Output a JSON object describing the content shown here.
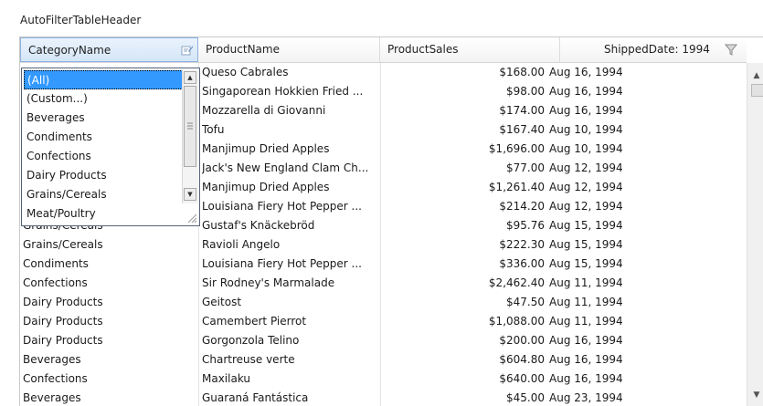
{
  "title": "AutoFilterTableHeader",
  "headers": {
    "category": "CategoryName",
    "product": "ProductName",
    "sales": "ProductSales",
    "shipped": "ShippedDate: 1994"
  },
  "dropdown": {
    "items": [
      "(All)",
      "(Custom...)",
      "Beverages",
      "Condiments",
      "Confections",
      "Dairy Products",
      "Grains/Cereals",
      "Meat/Poultry"
    ],
    "selected": "(All)"
  },
  "rows": [
    {
      "category": "",
      "product": "Queso Cabrales",
      "sales": "$168.00",
      "date": "Aug 16, 1994"
    },
    {
      "category": "",
      "product": "Singaporean Hokkien Fried ...",
      "sales": "$98.00",
      "date": "Aug 16, 1994"
    },
    {
      "category": "",
      "product": "Mozzarella di Giovanni",
      "sales": "$174.00",
      "date": "Aug 16, 1994"
    },
    {
      "category": "",
      "product": "Tofu",
      "sales": "$167.40",
      "date": "Aug 10, 1994"
    },
    {
      "category": "",
      "product": "Manjimup Dried Apples",
      "sales": "$1,696.00",
      "date": "Aug 10, 1994"
    },
    {
      "category": "",
      "product": "Jack's New England Clam Ch...",
      "sales": "$77.00",
      "date": "Aug 12, 1994"
    },
    {
      "category": "",
      "product": "Manjimup Dried Apples",
      "sales": "$1,261.40",
      "date": "Aug 12, 1994"
    },
    {
      "category": "",
      "product": "Louisiana Fiery Hot Pepper ...",
      "sales": "$214.20",
      "date": "Aug 12, 1994"
    },
    {
      "category": "Grains/Cereals",
      "product": "Gustaf's Knäckebröd",
      "sales": "$95.76",
      "date": "Aug 15, 1994"
    },
    {
      "category": "Grains/Cereals",
      "product": "Ravioli Angelo",
      "sales": "$222.30",
      "date": "Aug 15, 1994"
    },
    {
      "category": "Condiments",
      "product": "Louisiana Fiery Hot Pepper ...",
      "sales": "$336.00",
      "date": "Aug 15, 1994"
    },
    {
      "category": "Confections",
      "product": "Sir Rodney's Marmalade",
      "sales": "$2,462.40",
      "date": "Aug 11, 1994"
    },
    {
      "category": "Dairy Products",
      "product": "Geitost",
      "sales": "$47.50",
      "date": "Aug 11, 1994"
    },
    {
      "category": "Dairy Products",
      "product": "Camembert Pierrot",
      "sales": "$1,088.00",
      "date": "Aug 11, 1994"
    },
    {
      "category": "Dairy Products",
      "product": "Gorgonzola Telino",
      "sales": "$200.00",
      "date": "Aug 16, 1994"
    },
    {
      "category": "Beverages",
      "product": "Chartreuse verte",
      "sales": "$604.80",
      "date": "Aug 16, 1994"
    },
    {
      "category": "Confections",
      "product": "Maxilaku",
      "sales": "$640.00",
      "date": "Aug 16, 1994"
    },
    {
      "category": "Beverages",
      "product": "Guaraná Fantástica",
      "sales": "$45.00",
      "date": "Aug 23, 1994"
    }
  ],
  "icons": {
    "category_filter": "filter-edit-icon",
    "shipped_filter": "funnel-icon"
  },
  "colors": {
    "selection": "#3399ff",
    "header_active": "#d5e6f7",
    "dropdown_border": "#55627a"
  }
}
